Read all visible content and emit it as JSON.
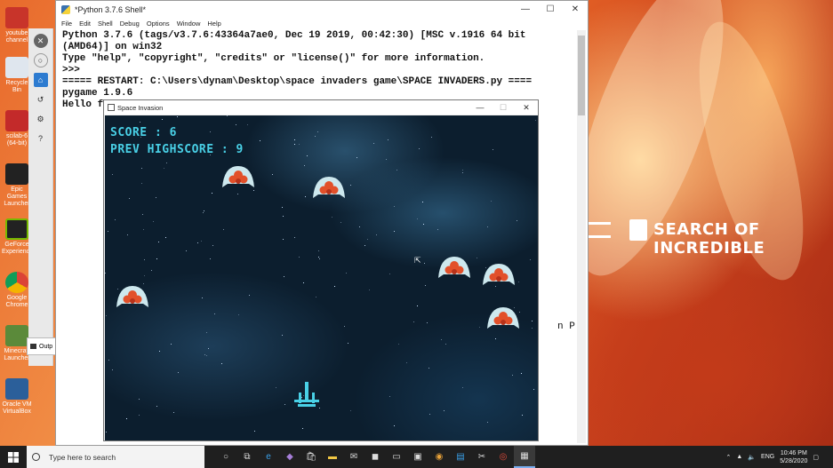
{
  "shell": {
    "title": "*Python 3.7.6 Shell*",
    "menu": [
      "File",
      "Edit",
      "Shell",
      "Debug",
      "Options",
      "Window",
      "Help"
    ],
    "lines": [
      "Python 3.7.6 (tags/v3.7.6:43364a7ae0, Dec 19 2019, 00:42:30) [MSC v.1916 64 bit",
      "(AMD64)] on win32",
      "Type \"help\", \"copyright\", \"credits\" or \"license()\" for more information.",
      ">>> ",
      "===== RESTART: C:\\Users\\dynam\\Desktop\\space invaders game\\SPACE INVADERS.py ====",
      "pygame 1.9.6",
      "Hello f"
    ],
    "stray": "n P"
  },
  "game": {
    "title": "Space Invasion",
    "score_text": "SCORE : 6",
    "highscore_text": "PREV HIGHSCORE : 9"
  },
  "desktop": {
    "brand_text": "SEARCH OF INCREDIBLE",
    "icons": [
      "youtube channel",
      "Recycle Bin",
      "scilab-6 (64-bit)",
      "Epic Games Launcher",
      "GeForce Experience",
      "Google Chrome",
      "Minecraft Launcher",
      "Oracle VM VirtualBox"
    ],
    "output_label": "Outp"
  },
  "taskbar": {
    "search_placeholder": "Type here to search",
    "lang": "ENG",
    "time": "10:46 PM",
    "date": "5/28/2020"
  },
  "colors": {
    "hud": "#49d0e6",
    "alien_shell": "#cde8ee",
    "alien_core": "#e2502a"
  }
}
